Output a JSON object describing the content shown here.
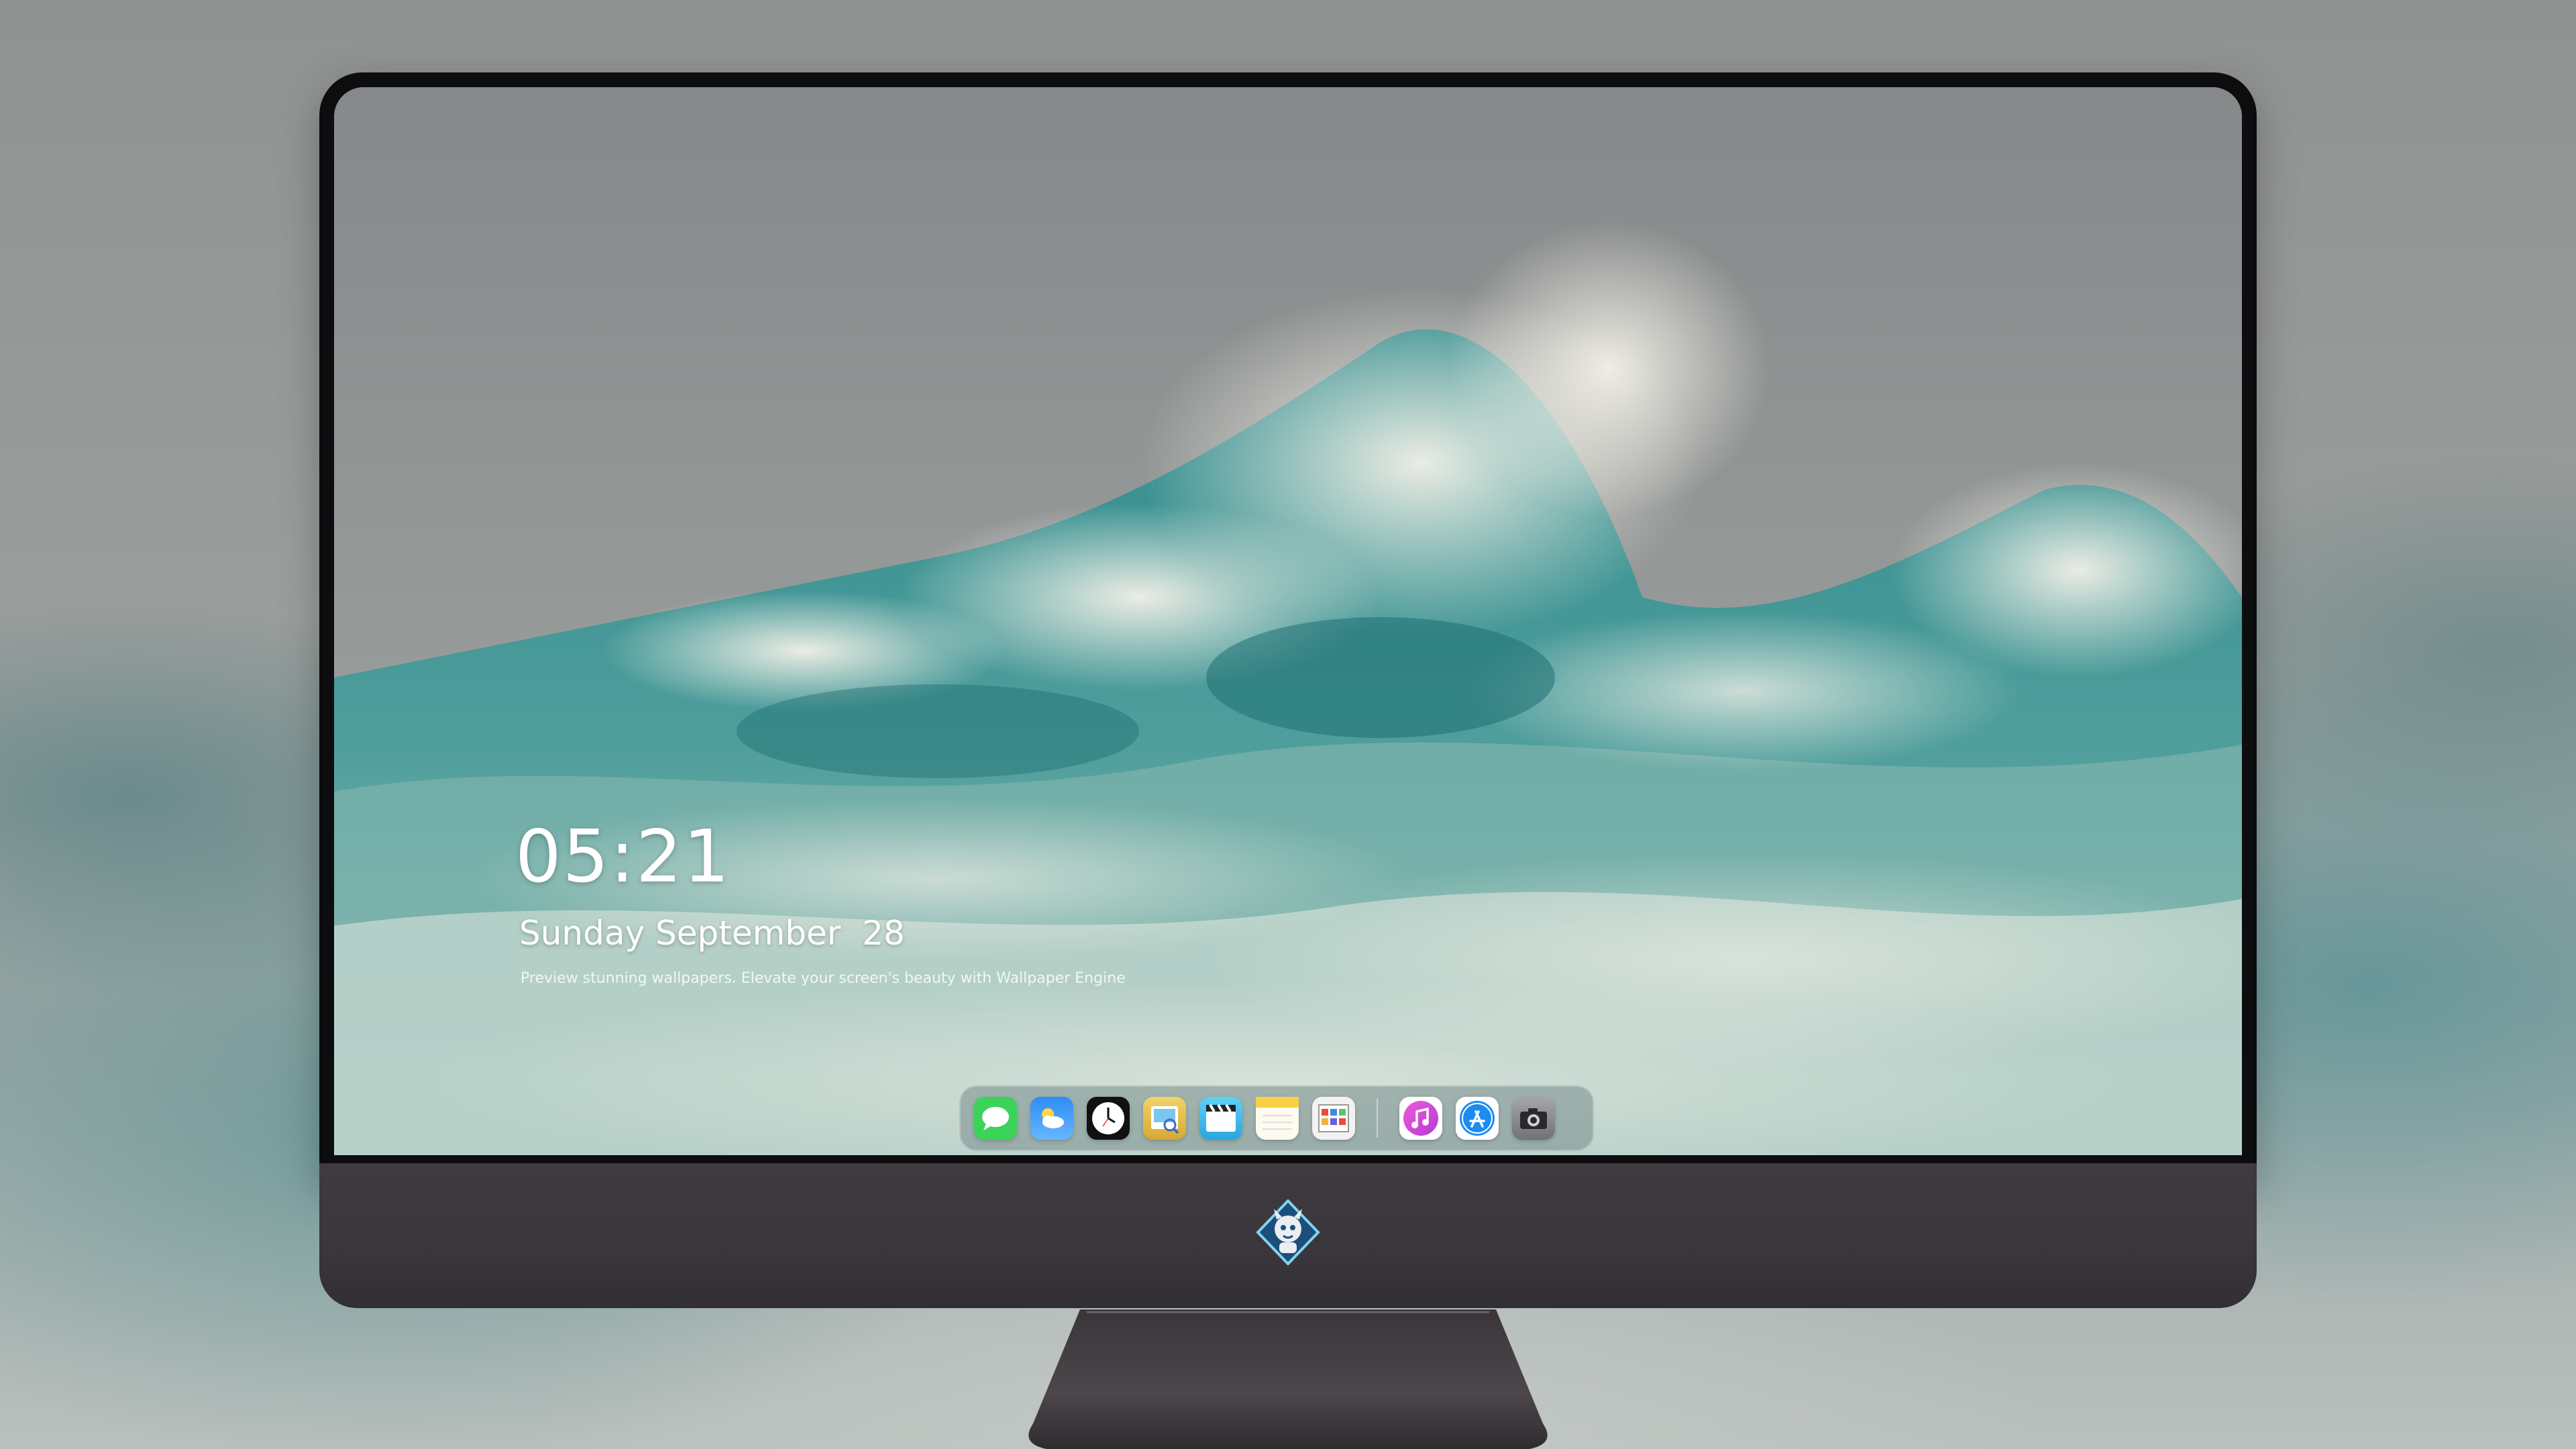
{
  "lock_screen": {
    "time": "05:21",
    "date": "Sunday September  28",
    "tagline": "Preview stunning wallpapers. Elevate your screen's beauty with Wallpaper Engine"
  },
  "dock": {
    "apps": [
      {
        "icon": "messages-icon",
        "color": "#3bd35a"
      },
      {
        "icon": "weather-icon",
        "color": "#2f8cf5"
      },
      {
        "icon": "clock-icon",
        "color": "#111111"
      },
      {
        "icon": "preview-icon",
        "color": "#e9c24a"
      },
      {
        "icon": "clips-icon",
        "color": "#34b3e6"
      },
      {
        "icon": "notes-icon",
        "color": "#f7d046"
      },
      {
        "icon": "calendar-grid-icon",
        "color": "#f2f2f2"
      },
      {
        "icon": "music-icon",
        "color": "#e147c8"
      },
      {
        "icon": "app-store-icon",
        "color": "#1b8cf2"
      },
      {
        "icon": "camera-icon",
        "color": "#8e9094"
      }
    ]
  },
  "chin": {
    "logo": "mascot-logo-icon"
  }
}
